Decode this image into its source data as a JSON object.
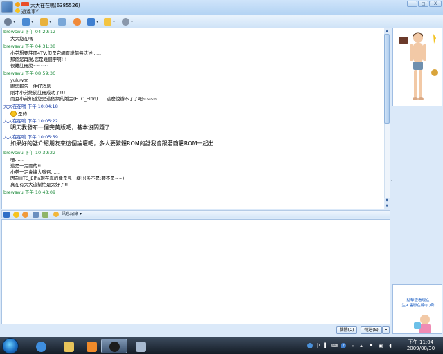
{
  "window": {
    "title": "大大在在鳴(6385526)",
    "status_text": "逍遙事件",
    "controls": [
      "_",
      "□",
      "X"
    ]
  },
  "toolbar": {
    "dropdown_glyph": "▾"
  },
  "history": {
    "messages": [
      {
        "kind": "header",
        "sender": "brewswu",
        "time": "下午 04:29:12",
        "color": "green"
      },
      {
        "kind": "text",
        "text": "大大您在嗎"
      },
      {
        "kind": "header",
        "sender": "brewswu",
        "time": "下午 04:31:38",
        "color": "green"
      },
      {
        "kind": "text",
        "text": "小弟想要註冊4TV,但是它網頁說前無法述......"
      },
      {
        "kind": "text",
        "text": "那個您再說,您是幾個字啊!!!"
      },
      {
        "kind": "text",
        "text": "很難註冊說~~~~"
      },
      {
        "kind": "header",
        "sender": "brewswu",
        "time": "下午 08:59:36",
        "color": "green"
      },
      {
        "kind": "text",
        "text": "yuluw大"
      },
      {
        "kind": "text",
        "text": "跟您報告一件好消息"
      },
      {
        "kind": "text",
        "text": "剛才小弟終於註冊成功了!!!!"
      },
      {
        "kind": "text",
        "text": "而且小弟知道您是這個網的版主(HTC_Elfin)......這麼說辦不了了吧~~~~"
      },
      {
        "kind": "header",
        "sender": "大大在在鳴",
        "time": "下午 10:04:18",
        "color": "blue"
      },
      {
        "kind": "text",
        "text": "是的",
        "smiley": true
      },
      {
        "kind": "header",
        "sender": "大大在在鳴",
        "time": "下午 10:05:22",
        "color": "blue"
      },
      {
        "kind": "text",
        "text": "明天我發布一個完美版吧，基本沒問題了",
        "big": true
      },
      {
        "kind": "header",
        "sender": "大大在在鳴",
        "time": "下午 10:05:59",
        "color": "blue"
      },
      {
        "kind": "text",
        "text": "如果好的話介紹朋友來這個論壇吧，多人要繁體ROM的話我會跟著簡體ROM一起出",
        "big": true
      },
      {
        "kind": "header",
        "sender": "brewswu",
        "time": "下午 10:39:22",
        "color": "green"
      },
      {
        "kind": "text",
        "text": "嗯......"
      },
      {
        "kind": "text",
        "text": "這是一定要的!!!"
      },
      {
        "kind": "text",
        "text": "小弟一定會擴大號召......"
      },
      {
        "kind": "text",
        "text": "因為HTC_Elfin現在真的像是見一樣!!(多不是:要不是~~)"
      },
      {
        "kind": "text",
        "text": "真在有大大這幫忙是太好了!!"
      },
      {
        "kind": "header",
        "sender": "brewswu",
        "time": "下午 10:48:09",
        "color": "green"
      }
    ]
  },
  "format_toolbar": {
    "message_log_label": "訊息記錄 ▾"
  },
  "buttons": {
    "close_label": "關閉(C)",
    "send_label": "傳送(S)",
    "send_dropdown": "▾"
  },
  "right_panel": {
    "collapse_glyph": "‹",
    "ad_text": "點擊查看現在\n生9 售戀在線QQ秀"
  },
  "taskbar": {
    "clock_time": "下午 11:04",
    "clock_date": "2009/08/30",
    "tray_ime": "中"
  },
  "colors": {
    "sender_green": "#1b8a3a",
    "sender_blue": "#1a3fa8",
    "window_bg": "#dbe9f9",
    "taskbar": "#1e2733"
  }
}
